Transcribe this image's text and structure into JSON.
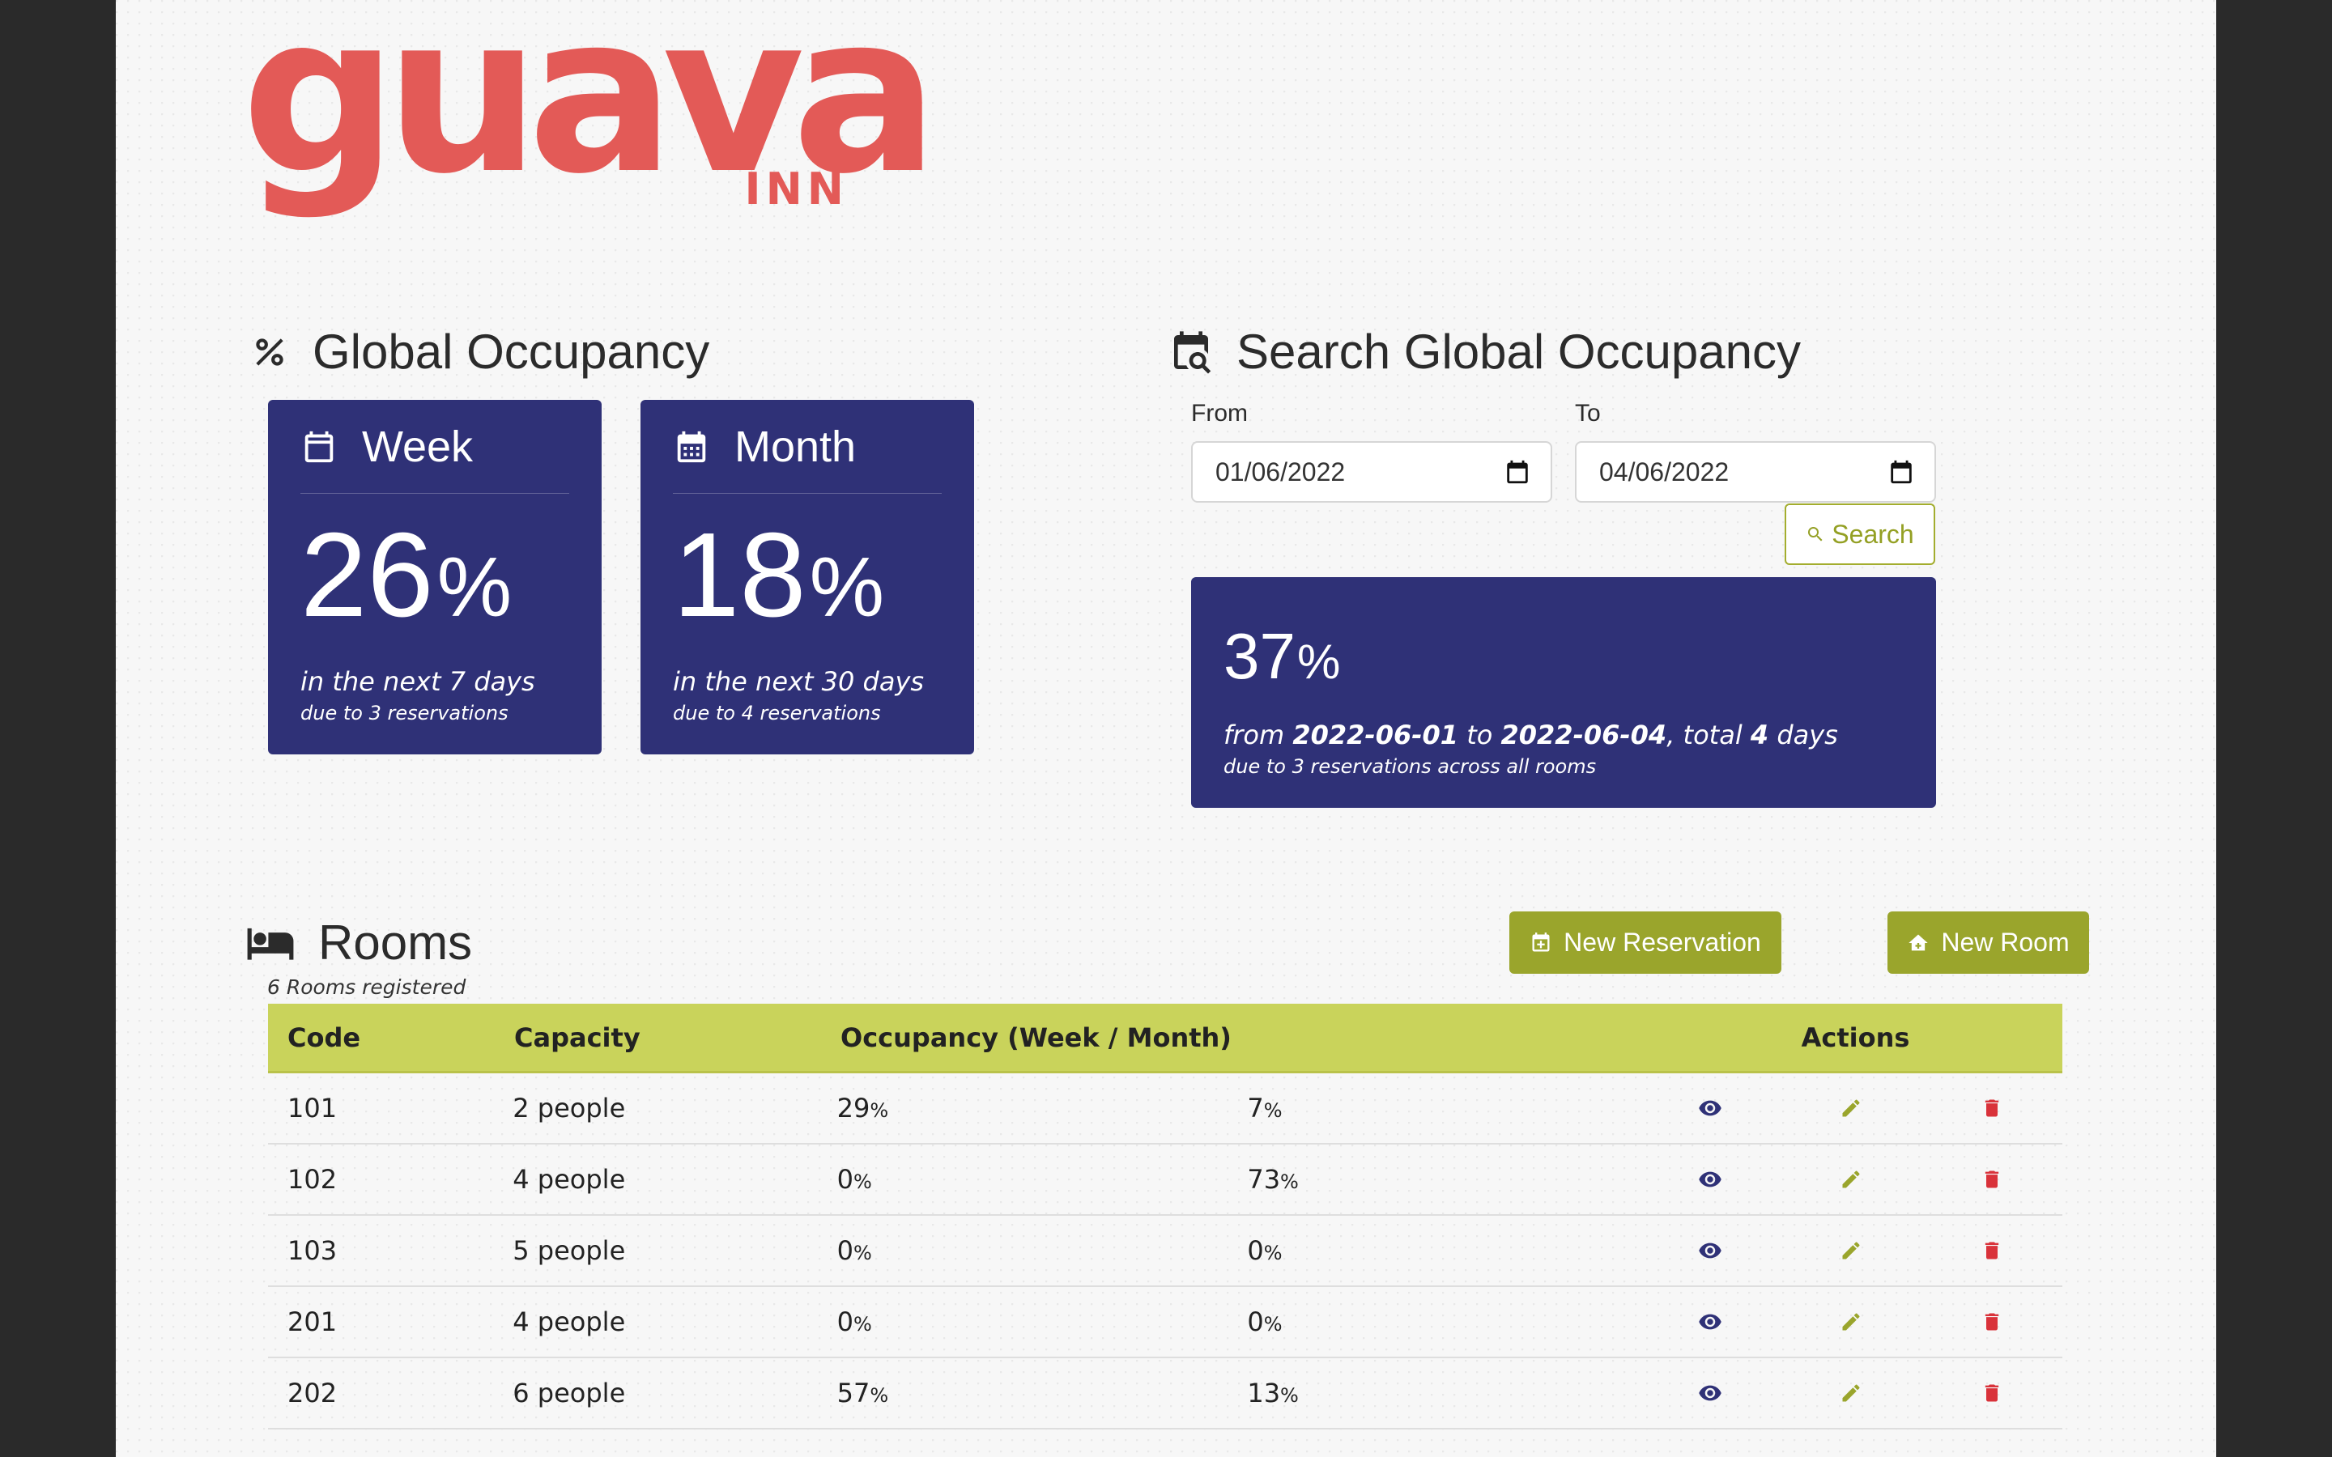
{
  "logo": {
    "main": "guava",
    "sub": "INN"
  },
  "global_occupancy": {
    "title": "Global Occupancy",
    "week": {
      "label": "Week",
      "value": "26",
      "unit": "%",
      "line1": "in the next 7 days",
      "line2": "due to 3 reservations"
    },
    "month": {
      "label": "Month",
      "value": "18",
      "unit": "%",
      "line1": "in the next 30 days",
      "line2": "due to 4 reservations"
    }
  },
  "search": {
    "title": "Search Global Occupancy",
    "from_label": "From",
    "from_value": "01/06/2022",
    "to_label": "To",
    "to_value": "04/06/2022",
    "button_label": "Search",
    "result": {
      "value": "37",
      "unit": "%",
      "from_word": "from",
      "start": "2022-06-01",
      "to_word": "to",
      "end": "2022-06-04",
      "total_word": ", total",
      "days": "4",
      "days_word": "days",
      "line2": "due to 3 reservations across all rooms"
    }
  },
  "rooms": {
    "title": "Rooms",
    "count_text": "6 Rooms registered",
    "new_reservation_label": "New Reservation",
    "new_room_label": "New Room",
    "headers": {
      "code": "Code",
      "capacity": "Capacity",
      "occupancy": "Occupancy (Week / Month)",
      "actions": "Actions"
    },
    "rows": [
      {
        "code": "101",
        "capacity": "2 people",
        "week": "29",
        "month": "7"
      },
      {
        "code": "102",
        "capacity": "4 people",
        "week": "0",
        "month": "73"
      },
      {
        "code": "103",
        "capacity": "5 people",
        "week": "0",
        "month": "0"
      },
      {
        "code": "201",
        "capacity": "4 people",
        "week": "0",
        "month": "0"
      },
      {
        "code": "202",
        "capacity": "6 people",
        "week": "57",
        "month": "13"
      }
    ],
    "pct_unit": "%"
  },
  "colors": {
    "brand": "#e35a57",
    "card": "#2f3177",
    "accent": "#9aa52c",
    "header": "#c9d35b",
    "danger": "#d9323a"
  },
  "icons": [
    "percent-icon",
    "calendar-icon",
    "calendar-month-icon",
    "calendar-search-icon",
    "search-icon",
    "calendar-plus-icon",
    "home-add-icon",
    "bed-icon",
    "eye-icon",
    "pencil-icon",
    "trash-icon"
  ]
}
